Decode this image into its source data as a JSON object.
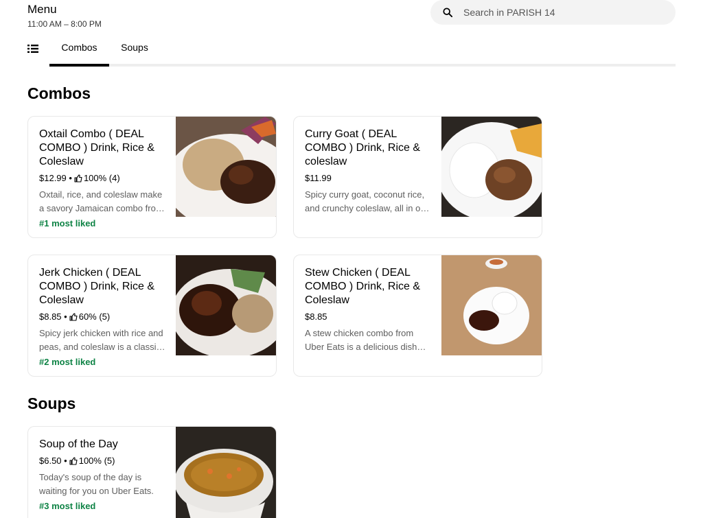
{
  "header": {
    "title": "Menu",
    "hours": "11:00 AM – 8:00 PM"
  },
  "search": {
    "placeholder": "Search in PARISH 14",
    "value": ""
  },
  "tabs": [
    {
      "label": "Combos",
      "active": true
    },
    {
      "label": "Soups",
      "active": false
    }
  ],
  "sections": {
    "combos": {
      "title": "Combos",
      "items": [
        {
          "name": "Oxtail Combo ( DEAL COMBO ) Drink, Rice & Coleslaw",
          "price": "$12.99",
          "rating": "100% (4)",
          "description": "Oxtail, rice, and coleslaw make a savory Jamaican combo from Uber Eats.",
          "badge": "#1 most liked"
        },
        {
          "name": "Curry Goat ( DEAL COMBO ) Drink, Rice & coleslaw",
          "price": "$11.99",
          "rating": "",
          "description": "Spicy curry goat, coconut rice, and crunchy coleslaw, all in one combo.",
          "badge": ""
        },
        {
          "name": "Jerk Chicken ( DEAL COMBO ) Drink, Rice & Coleslaw",
          "price": "$8.85",
          "rating": "60% (5)",
          "description": "Spicy jerk chicken with rice and peas, and coleslaw is a classic combo.",
          "badge": "#2 most liked"
        },
        {
          "name": "Stew Chicken ( DEAL COMBO ) Drink, Rice & Coleslaw",
          "price": "$8.85",
          "rating": "",
          "description": "A stew chicken combo from Uber Eats is a delicious dish with rice and slaw.",
          "badge": ""
        }
      ]
    },
    "soups": {
      "title": "Soups",
      "items": [
        {
          "name": "Soup of the Day",
          "price": "$6.50",
          "rating": "100% (5)",
          "description": "Today's soup of the day is waiting for you on Uber Eats.",
          "badge": "#3 most liked"
        }
      ]
    }
  },
  "colors": {
    "badge_green": "#0e8345",
    "search_bg": "#f3f3f3",
    "description_gray": "#5e5e5e"
  },
  "icons": {
    "search": "search-icon",
    "list": "list-icon",
    "thumbs_up": "thumbs-up-icon"
  }
}
